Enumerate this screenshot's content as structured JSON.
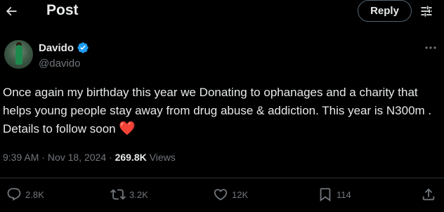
{
  "header": {
    "title": "Post",
    "reply_label": "Reply",
    "back_icon": "arrow-left-icon",
    "filter_icon": "sliders-icon"
  },
  "author": {
    "name": "Davido",
    "handle": "@davido",
    "verified": true,
    "verified_color": "#1d9bf0"
  },
  "tweet": {
    "text": "Once again  my birthday this year  we Donating to ophanages and a charity that helps young people stay away from drug abuse & addiction. This year is N300m . Details to follow soon",
    "emoji": "❤️"
  },
  "meta": {
    "time": "9:39 AM",
    "separator": "·",
    "date": "Nov 18, 2024",
    "views_count": "269.8K",
    "views_label": "Views"
  },
  "actions": {
    "replies": "2.8K",
    "reposts": "3.2K",
    "likes": "12K",
    "bookmarks": "114"
  },
  "colors": {
    "background": "#000000",
    "text": "#e7e9ea",
    "muted": "#71767b",
    "heart": "#f91880"
  }
}
